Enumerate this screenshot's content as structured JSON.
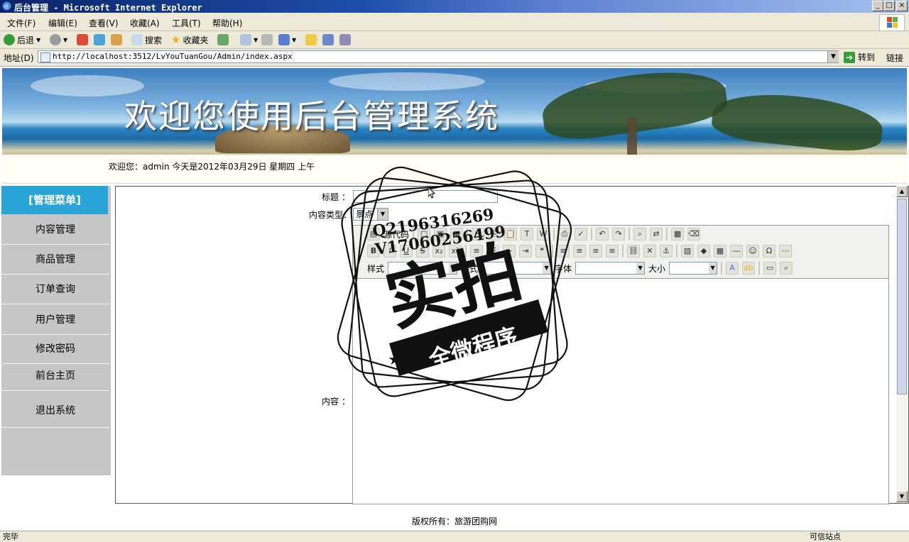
{
  "window": {
    "title": "后台管理 - Microsoft Internet Explorer"
  },
  "menubar": {
    "items": [
      "文件(F)",
      "编辑(E)",
      "查看(V)",
      "收藏(A)",
      "工具(T)",
      "帮助(H)"
    ]
  },
  "toolbar": {
    "back": "后退",
    "search": "搜索",
    "favorites": "收藏夹"
  },
  "address": {
    "label": "地址(D)",
    "url": "http://localhost:3512/LvYouTuanGou/Admin/index.aspx",
    "go": "转到",
    "links": "链接"
  },
  "banner": {
    "title": "欢迎您使用后台管理系统"
  },
  "welcome": {
    "text": "欢迎您：admin   今天是2012年03月29日   星期四   上午"
  },
  "sidebar": {
    "header": "[管理菜单]",
    "items": [
      {
        "label": "内容管理"
      },
      {
        "label": "商品管理"
      },
      {
        "label": "订单查询"
      },
      {
        "label": "用户管理"
      },
      {
        "label": "修改密码"
      },
      {
        "label": "前台主页"
      },
      {
        "label": "退出系统"
      }
    ]
  },
  "form": {
    "title_label": "标题 ：",
    "type_label": "内容类型：",
    "type_value": "景点",
    "content_label": "内容 ："
  },
  "editor": {
    "source_label": "源代码",
    "style_label": "样式",
    "format_label": "格式",
    "font_label": "字体",
    "size_label": "大小"
  },
  "footer": {
    "text": "版权所有：旅游团购网"
  },
  "status": {
    "left": "完毕",
    "right": "可信站点"
  },
  "watermark": {
    "line1": "Q2196316269",
    "line2": "V17060256499",
    "big": "实拍",
    "ribbon": "全微程序"
  }
}
